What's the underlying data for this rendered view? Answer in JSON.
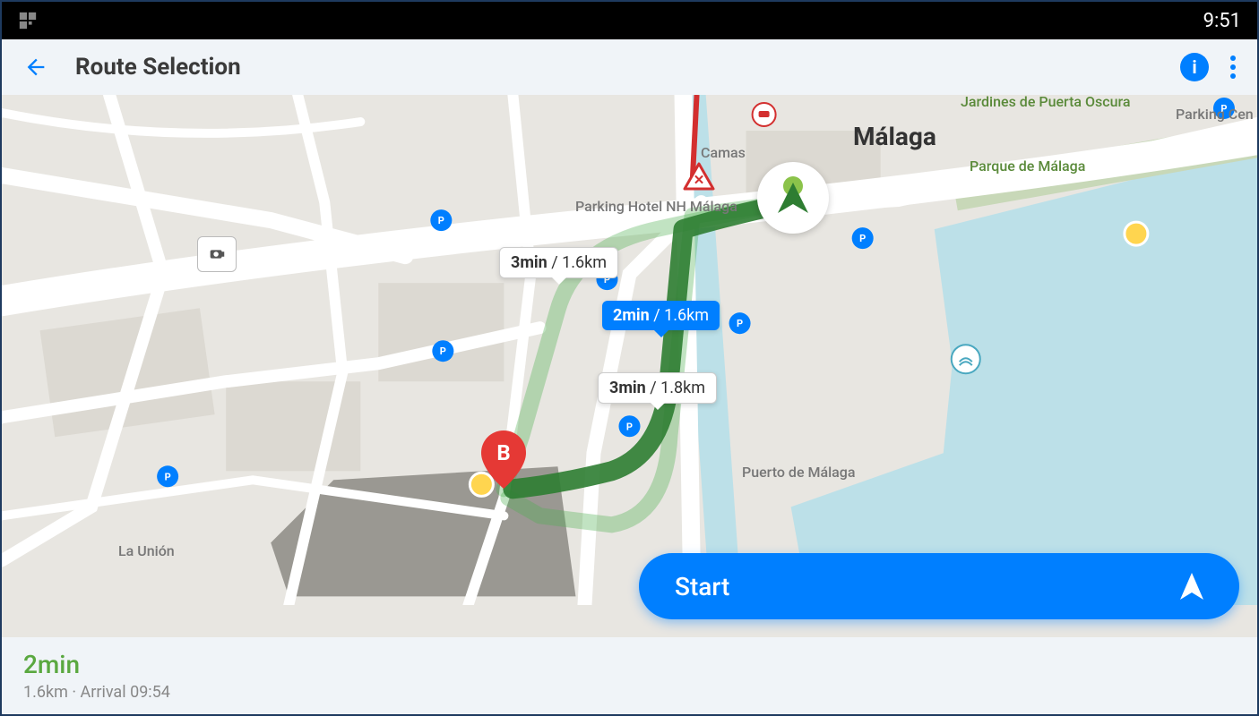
{
  "status": {
    "time": "9:51"
  },
  "header": {
    "title": "Route Selection"
  },
  "map": {
    "city_label": "Málaga",
    "labels": {
      "camas": "Camas",
      "union": "La Unión",
      "parking_nh": "Parking Hotel NH Málaga",
      "puerto": "Puerto de Málaga",
      "parque": "Parque de Málaga",
      "jardines": "Jardines de Puerta Oscura",
      "parking_cen": "Parking Cen"
    },
    "destination_letter": "B",
    "routes": [
      {
        "time": "3min",
        "dist": "1.6km",
        "selected": false
      },
      {
        "time": "2min",
        "dist": "1.6km",
        "selected": true
      },
      {
        "time": "3min",
        "dist": "1.8km",
        "selected": false
      }
    ]
  },
  "start_button": "Start",
  "footer": {
    "time": "2min",
    "distance": "1.6km",
    "arrival_prefix": "Arrival",
    "arrival_time": "09:54"
  }
}
